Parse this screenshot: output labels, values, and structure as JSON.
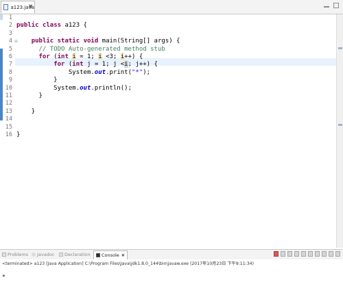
{
  "editor": {
    "tab_label": "a123.java",
    "tab_close": "✖",
    "fold_marker": "⊖",
    "line_numbers": [
      "1",
      "2",
      "3",
      "4",
      "5",
      "6",
      "7",
      "8",
      "9",
      "10",
      "11",
      "12",
      "13",
      "14",
      "15",
      "16"
    ]
  },
  "console_panel": {
    "tabs": [
      {
        "label": "Problems"
      },
      {
        "label": "Javadoc"
      },
      {
        "label": "Declaration"
      },
      {
        "label": "Console",
        "close": "✖"
      }
    ],
    "status": "<terminated> a123 [Java Application] C:\\Program Files\\Java\\jdk1.8.0_144\\bin\\javaw.exe (2017年10月23日 下午9:11:34)",
    "output": "*"
  },
  "colors": {
    "keyword": "#7f0055",
    "comment": "#3f7f5f",
    "string": "#2a00ff",
    "static_field": "#0000c0",
    "current_line": "#e8f2fe"
  }
}
